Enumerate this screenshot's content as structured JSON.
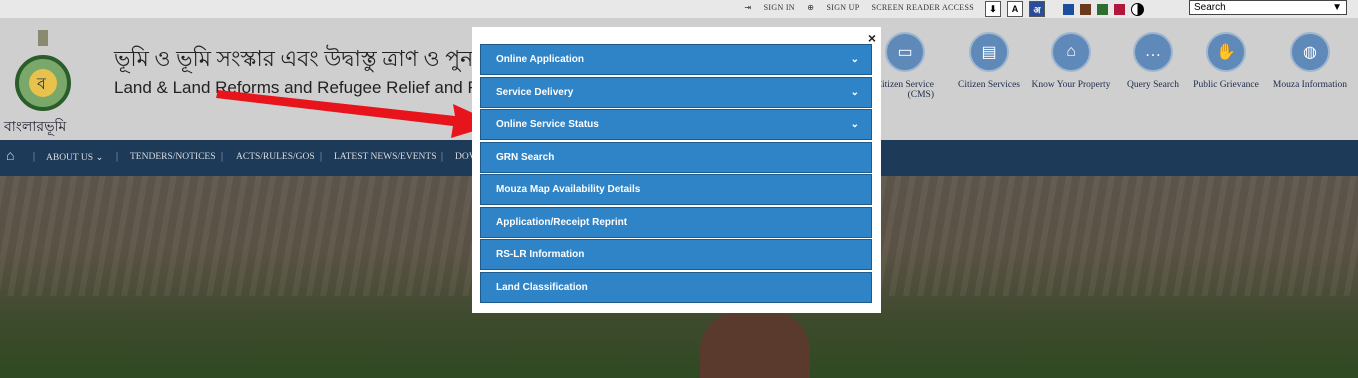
{
  "topbar": {
    "sign_in": "SIGN IN",
    "sign_up": "SIGN UP",
    "screen_reader": "SCREEN READER ACCESS",
    "search_value": "Search",
    "theme_colors": [
      "#1a4fa0",
      "#6b3a1e",
      "#2f6e2f",
      "#b0173b"
    ]
  },
  "header": {
    "title_bengali": "ভূমি ও ভূমি সংস্কার এবং উদ্বাস্তু ত্রাণ ও পুনর্বাসন",
    "title_english": "Land & Land Reforms and Refugee Relief and Rehabilitation D",
    "brand_bengali": "বাংলারভূমি",
    "services": [
      {
        "label": "Citizen Service\n(CMS)",
        "icon": "monitor-icon"
      },
      {
        "label": "Citizen Services",
        "icon": "id-card-icon"
      },
      {
        "label": "Know Your Property",
        "icon": "home-icon"
      },
      {
        "label": "Query Search",
        "icon": "chat-icon"
      },
      {
        "label": "Public Grievance",
        "icon": "hand-icon"
      },
      {
        "label": "Mouza Information",
        "icon": "globe-icon"
      }
    ]
  },
  "nav": {
    "items": [
      "ABOUT US",
      "TENDERS/NOTICES",
      "ACTS/RULES/GOS",
      "LATEST NEWS/EVENTS",
      "DOV"
    ]
  },
  "modal": {
    "close_label": "×",
    "items": [
      {
        "label": "Online Application",
        "expandable": true
      },
      {
        "label": "Service Delivery",
        "expandable": true
      },
      {
        "label": "Online Service Status",
        "expandable": true
      },
      {
        "label": "GRN Search",
        "expandable": false
      },
      {
        "label": "Mouza Map Availability Details",
        "expandable": false
      },
      {
        "label": "Application/Receipt Reprint",
        "expandable": false
      },
      {
        "label": "RS-LR Information",
        "expandable": false
      },
      {
        "label": "Land Classification",
        "expandable": false
      }
    ]
  },
  "colors": {
    "menu_item": "#2f83c7",
    "nav_bar": "#1d3a58",
    "arrow": "#e8141c"
  }
}
